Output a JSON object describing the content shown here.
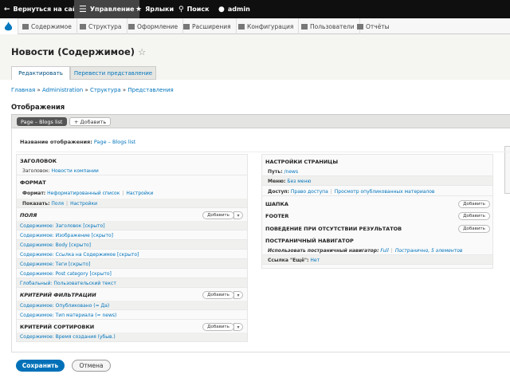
{
  "toolbar": {
    "back": "Вернуться на сайт",
    "manage": "Управление",
    "shortcuts": "Ярлыки",
    "search": "Поиск",
    "user": "admin"
  },
  "menu": [
    "Содержимое",
    "Структура",
    "Оформление",
    "Расширения",
    "Конфигурация",
    "Пользователи",
    "Отчёты"
  ],
  "page": {
    "title": "Новости (Содержимое)",
    "tab_edit": "Редактировать",
    "tab_translate": "Перевести представление",
    "breadcrumb": [
      "Главная",
      "Administration",
      "Структура",
      "Представления"
    ],
    "section": "Отображения"
  },
  "displays": {
    "current": "Page – Blogs list",
    "add": "+ Добавить",
    "name_label": "Название отображения:",
    "name_value": "Page – Blogs list"
  },
  "left": {
    "header_title": "Заголовок",
    "header_label": "Заголовок:",
    "header_value": "Новости компании",
    "format_title": "Формат",
    "format_label": "Формат:",
    "format_value": "Неформатированный список",
    "format_settings": "Настройки",
    "show_label": "Показать:",
    "show_value": "Поля",
    "show_settings": "Настройки",
    "fields_title": "Поля",
    "fields": [
      "Содержимое: Заголовок [скрыто]",
      "Содержимое: Изображение [скрыто]",
      "Содержимое: Body [скрыто]",
      "Содержимое: Ссылка на Содержимое [скрыто]",
      "Содержимое: Теги [скрыто]",
      "Содержимое: Post category [скрыто]",
      "Глобальный: Пользовательский текст"
    ],
    "filter_title": "Критерий фильтрации",
    "filters": [
      "Содержимое: Опубликовано (= Да)",
      "Содержимое: Тип материала (= news)"
    ],
    "sort_title": "Критерий сортировки",
    "sorts": [
      "Содержимое: Время создания (убыв.)"
    ],
    "add": "Добавить"
  },
  "right": {
    "page_title": "Настройки страницы",
    "path_label": "Путь:",
    "path_value": "/news",
    "menu_label": "Меню:",
    "menu_value": "Без меню",
    "access_label": "Доступ:",
    "access_value": "Право доступа",
    "access_value2": "Просмотр опубликованных материалов",
    "header": "Шапка",
    "footer": "Footer",
    "empty": "Поведение при отсутствии результатов",
    "pager_title": "Постраничный навигатор",
    "pager_label": "Использовать постраничный навигатор:",
    "pager_value": "Full",
    "pager_value2": "Постранично, 5 элементов",
    "more_label": "Ссылка \"Ещё\":",
    "more_value": "Нет",
    "add": "Добавить"
  },
  "actions": {
    "save": "Сохранить",
    "cancel": "Отмена"
  }
}
